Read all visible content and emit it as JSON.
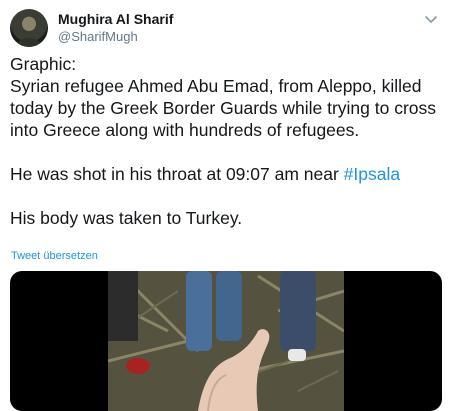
{
  "author": {
    "name": "Mughira Al Sharif",
    "handle": "@SharifMugh"
  },
  "tweet": {
    "line1": "Graphic:",
    "line2": "Syrian refugee Ahmed Abu Emad, from Aleppo, killed today by the Greek Border Guards while trying to cross into Greece along with hundreds of refugees.",
    "line3_prefix": "He was shot in his throat at 09:07 am near ",
    "line3_hashtag": "#Ipsala",
    "line4": "His body was taken to Turkey."
  },
  "translate_label": "Tweet übersetzen",
  "icons": {
    "menu": "chevron-down-icon",
    "avatar": "avatar"
  },
  "colors": {
    "link": "#1b95e0",
    "text": "#14171a",
    "secondary": "#657786"
  }
}
